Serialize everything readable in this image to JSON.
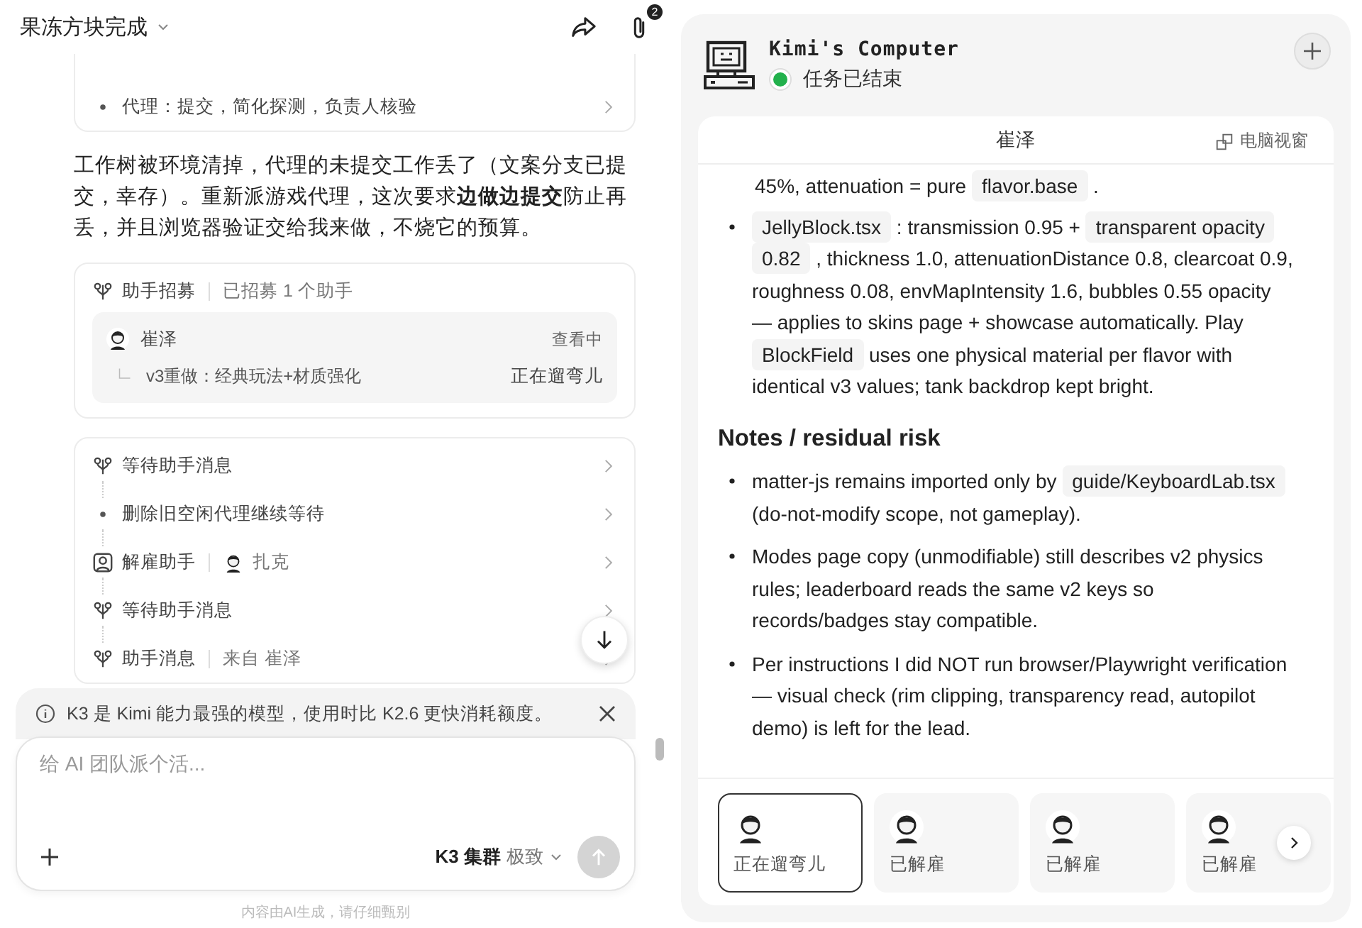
{
  "header": {
    "title": "果冻方块完成",
    "attachment_count": "2"
  },
  "chat": [
    {
      "kind": "steps",
      "clipped": true,
      "steps": [
        {
          "kind": "bullet",
          "label": "代理：提交，简化探测，负责人核验"
        }
      ]
    },
    {
      "kind": "text",
      "text": "工作树被环境清掉，代理的未提交工作丢了（文案分支已提交，幸存）。重新派游戏代理，这次要求**边做边提交**防止再丢，并且浏览器验证交给我来做，不烧它的预算。"
    },
    {
      "kind": "recruit",
      "title": "助手招募",
      "detail": "已招募 1 个助手",
      "assistant": {
        "name": "崔泽",
        "status": "查看中",
        "task": "v3重做：经典玩法+材质强化",
        "activity": "正在遛弯儿"
      }
    },
    {
      "kind": "steps",
      "clipped": false,
      "steps": [
        {
          "kind": "helper",
          "label": "等待助手消息"
        },
        {
          "kind": "bullet",
          "label": "删除旧空闲代理继续等待"
        },
        {
          "kind": "dismiss",
          "label": "解雇助手",
          "person": "扎克"
        },
        {
          "kind": "helper",
          "label": "等待助手消息"
        },
        {
          "kind": "helper",
          "label": "助手消息",
          "detail": "来自 崔泽"
        }
      ]
    }
  ],
  "notice": {
    "text": "K3 是 Kimi 能力最强的模型，使用时比 K2.6 更快消耗额度。"
  },
  "composer": {
    "placeholder": "给 AI 团队派个活...",
    "model": "K3 集群",
    "mode": "极致"
  },
  "footer": "内容由AI生成，请仔细甄别",
  "computer": {
    "title": "Kimi's Computer",
    "status": {
      "text": "任务已结束",
      "color": "#22b14c"
    },
    "tab": "崔泽",
    "view_link": "电脑视窗",
    "content": [
      {
        "kind": "para",
        "segments": [
          {
            "text": "45%, attenuation = pure "
          },
          {
            "text": "flavor.base",
            "code": true
          },
          {
            "text": " ."
          }
        ]
      },
      {
        "kind": "bullet",
        "segments": [
          {
            "text": "JellyBlock.tsx",
            "code": true
          },
          {
            "text": " : transmission 0.95 + "
          },
          {
            "text": "transparent opacity",
            "code": true
          },
          {
            "text": "0.82",
            "code": true
          },
          {
            "text": " , thickness 1.0, attenuationDistance 0.8, clearcoat 0.9, roughness 0.08, envMapIntensity 1.6, bubbles 0.55 opacity — applies to skins page + showcase automatically. Play "
          },
          {
            "text": "BlockField",
            "code": true
          },
          {
            "text": " uses one physical material per flavor with identical v3 values; tank backdrop kept bright."
          }
        ]
      },
      {
        "kind": "heading",
        "segments": [
          {
            "text": "Notes / residual risk"
          }
        ]
      },
      {
        "kind": "bullet",
        "segments": [
          {
            "text": "matter-js remains imported only by "
          },
          {
            "text": "guide/KeyboardLab.tsx",
            "code": true
          },
          {
            "text": " (do-not-modify scope, not gameplay)."
          }
        ]
      },
      {
        "kind": "bullet",
        "segments": [
          {
            "text": "Modes page copy (unmodifiable) still describes v2 physics rules; leaderboard reads the same v2 keys so records/badges stay compatible."
          }
        ]
      },
      {
        "kind": "bullet",
        "segments": [
          {
            "text": "Per instructions I did NOT run browser/Playwright verification — visual check (rim clipping, transparency read, autopilot demo) is left for the lead."
          }
        ]
      }
    ],
    "agents": [
      {
        "label": "正在遛弯儿",
        "selected": true
      },
      {
        "label": "已解雇",
        "selected": false
      },
      {
        "label": "已解雇",
        "selected": false
      },
      {
        "label": "已解雇",
        "selected": false
      }
    ]
  }
}
